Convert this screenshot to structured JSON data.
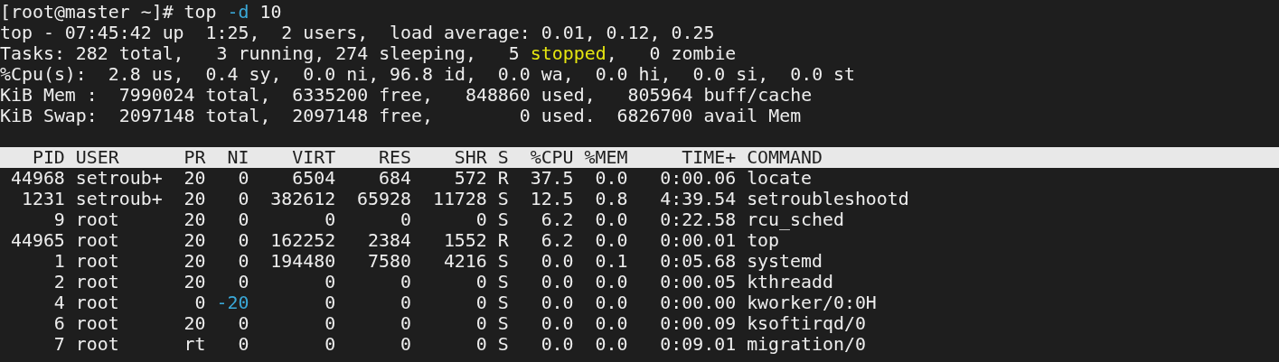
{
  "terminal": {
    "summary_lines": [
      {
        "segments": [
          {
            "text": "[root@master ~]# top "
          },
          {
            "text": "-d",
            "color": "#3aa8d8"
          },
          {
            "text": " 10"
          }
        ]
      },
      {
        "segments": [
          {
            "text": "top - 07:45:42 up  1:25,  2 users,  load average: 0.01, 0.12, 0.25"
          }
        ]
      },
      {
        "segments": [
          {
            "text": "Tasks: 282 total,   3 running, 274 sleeping,   5 "
          },
          {
            "text": "stopped",
            "color": "#e5e510"
          },
          {
            "text": ",   0 zombie"
          }
        ]
      },
      {
        "segments": [
          {
            "text": "%Cpu(s):  2.8 us,  0.4 sy,  0.0 ni, 96.8 id,  0.0 wa,  0.0 hi,  0.0 si,  0.0 st"
          }
        ]
      },
      {
        "segments": [
          {
            "text": "KiB Mem :  7990024 total,  6335200 free,   848860 used,   805964 buff/cache"
          }
        ]
      },
      {
        "segments": [
          {
            "text": "KiB Swap:  2097148 total,  2097148 free,        0 used.  6826700 avail Mem"
          }
        ]
      }
    ],
    "table": {
      "columns": [
        "PID",
        "USER",
        "PR",
        "NI",
        "VIRT",
        "RES",
        "SHR",
        "S",
        "%CPU",
        "%MEM",
        "TIME+",
        "COMMAND"
      ],
      "rows": [
        {
          "cells": [
            "44968",
            "setroub+",
            "20",
            "0",
            "6504",
            "684",
            "572",
            "R",
            "37.5",
            "0.0",
            "0:00.06",
            "locate"
          ]
        },
        {
          "cells": [
            "1231",
            "setroub+",
            "20",
            "0",
            "382612",
            "65928",
            "11728",
            "S",
            "12.5",
            "0.8",
            "4:39.54",
            "setroubleshootd"
          ]
        },
        {
          "cells": [
            "9",
            "root",
            "20",
            "0",
            "0",
            "0",
            "0",
            "S",
            "6.2",
            "0.0",
            "0:22.58",
            "rcu_sched"
          ]
        },
        {
          "cells": [
            "44965",
            "root",
            "20",
            "0",
            "162252",
            "2384",
            "1552",
            "R",
            "6.2",
            "0.0",
            "0:00.01",
            "top"
          ]
        },
        {
          "cells": [
            "1",
            "root",
            "20",
            "0",
            "194480",
            "7580",
            "4216",
            "S",
            "0.0",
            "0.1",
            "0:05.68",
            "systemd"
          ]
        },
        {
          "cells": [
            "2",
            "root",
            "20",
            "0",
            "0",
            "0",
            "0",
            "S",
            "0.0",
            "0.0",
            "0:00.05",
            "kthreadd"
          ]
        },
        {
          "cells": [
            "4",
            "root",
            "0",
            {
              "text": "-20",
              "color": "#3aa8d8"
            },
            "0",
            "0",
            "0",
            "S",
            "0.0",
            "0.0",
            "0:00.00",
            "kworker/0:0H"
          ]
        },
        {
          "cells": [
            "6",
            "root",
            "20",
            "0",
            "0",
            "0",
            "0",
            "S",
            "0.0",
            "0.0",
            "0:00.09",
            "ksoftirqd/0"
          ]
        },
        {
          "cells": [
            "7",
            "root",
            "rt",
            "0",
            "0",
            "0",
            "0",
            "S",
            "0.0",
            "0.0",
            "0:09.01",
            "migration/0"
          ]
        }
      ]
    }
  }
}
